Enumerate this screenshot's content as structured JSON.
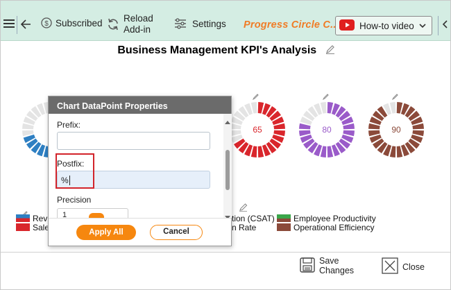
{
  "toolbar": {
    "subscribed_label": "Subscribed",
    "reload_label_1": "Reload",
    "reload_label_2": "Add-in",
    "settings_label": "Settings",
    "app_title": "Progress Circle C...",
    "howto_label": "How-to video"
  },
  "chart": {
    "title": "Business Management KPI's Analysis",
    "donuts": [
      {
        "value": "7",
        "color": "#2e7fc2"
      },
      {
        "value": "65",
        "color": "#d9262c"
      },
      {
        "value": "80",
        "color": "#9a5bc9"
      },
      {
        "value": "90",
        "color": "#8b4a3a"
      }
    ],
    "legend_left": [
      {
        "label": "Rev",
        "color": "#2e7fc2"
      },
      {
        "label": "Sale",
        "color": "#d9262c"
      }
    ],
    "legend_mid": [
      {
        "label": "tion (CSAT)"
      },
      {
        "label": "n Rate"
      }
    ],
    "legend_right": [
      {
        "label": "Employee Productivity",
        "color": "#3aa64a"
      },
      {
        "label": "Operational Efficiency",
        "color": "#8b4a3a"
      }
    ]
  },
  "dialog": {
    "title": "Chart DataPoint Properties",
    "prefix_label": "Prefix:",
    "prefix_value": "",
    "postfix_label": "Postfix:",
    "postfix_value": "%",
    "precision_label": "Precision",
    "precision_value": "1",
    "apply_label": "Apply All",
    "cancel_label": "Cancel"
  },
  "footer": {
    "save_label_1": "Save",
    "save_label_2": "Changes",
    "close_label": "Close"
  }
}
